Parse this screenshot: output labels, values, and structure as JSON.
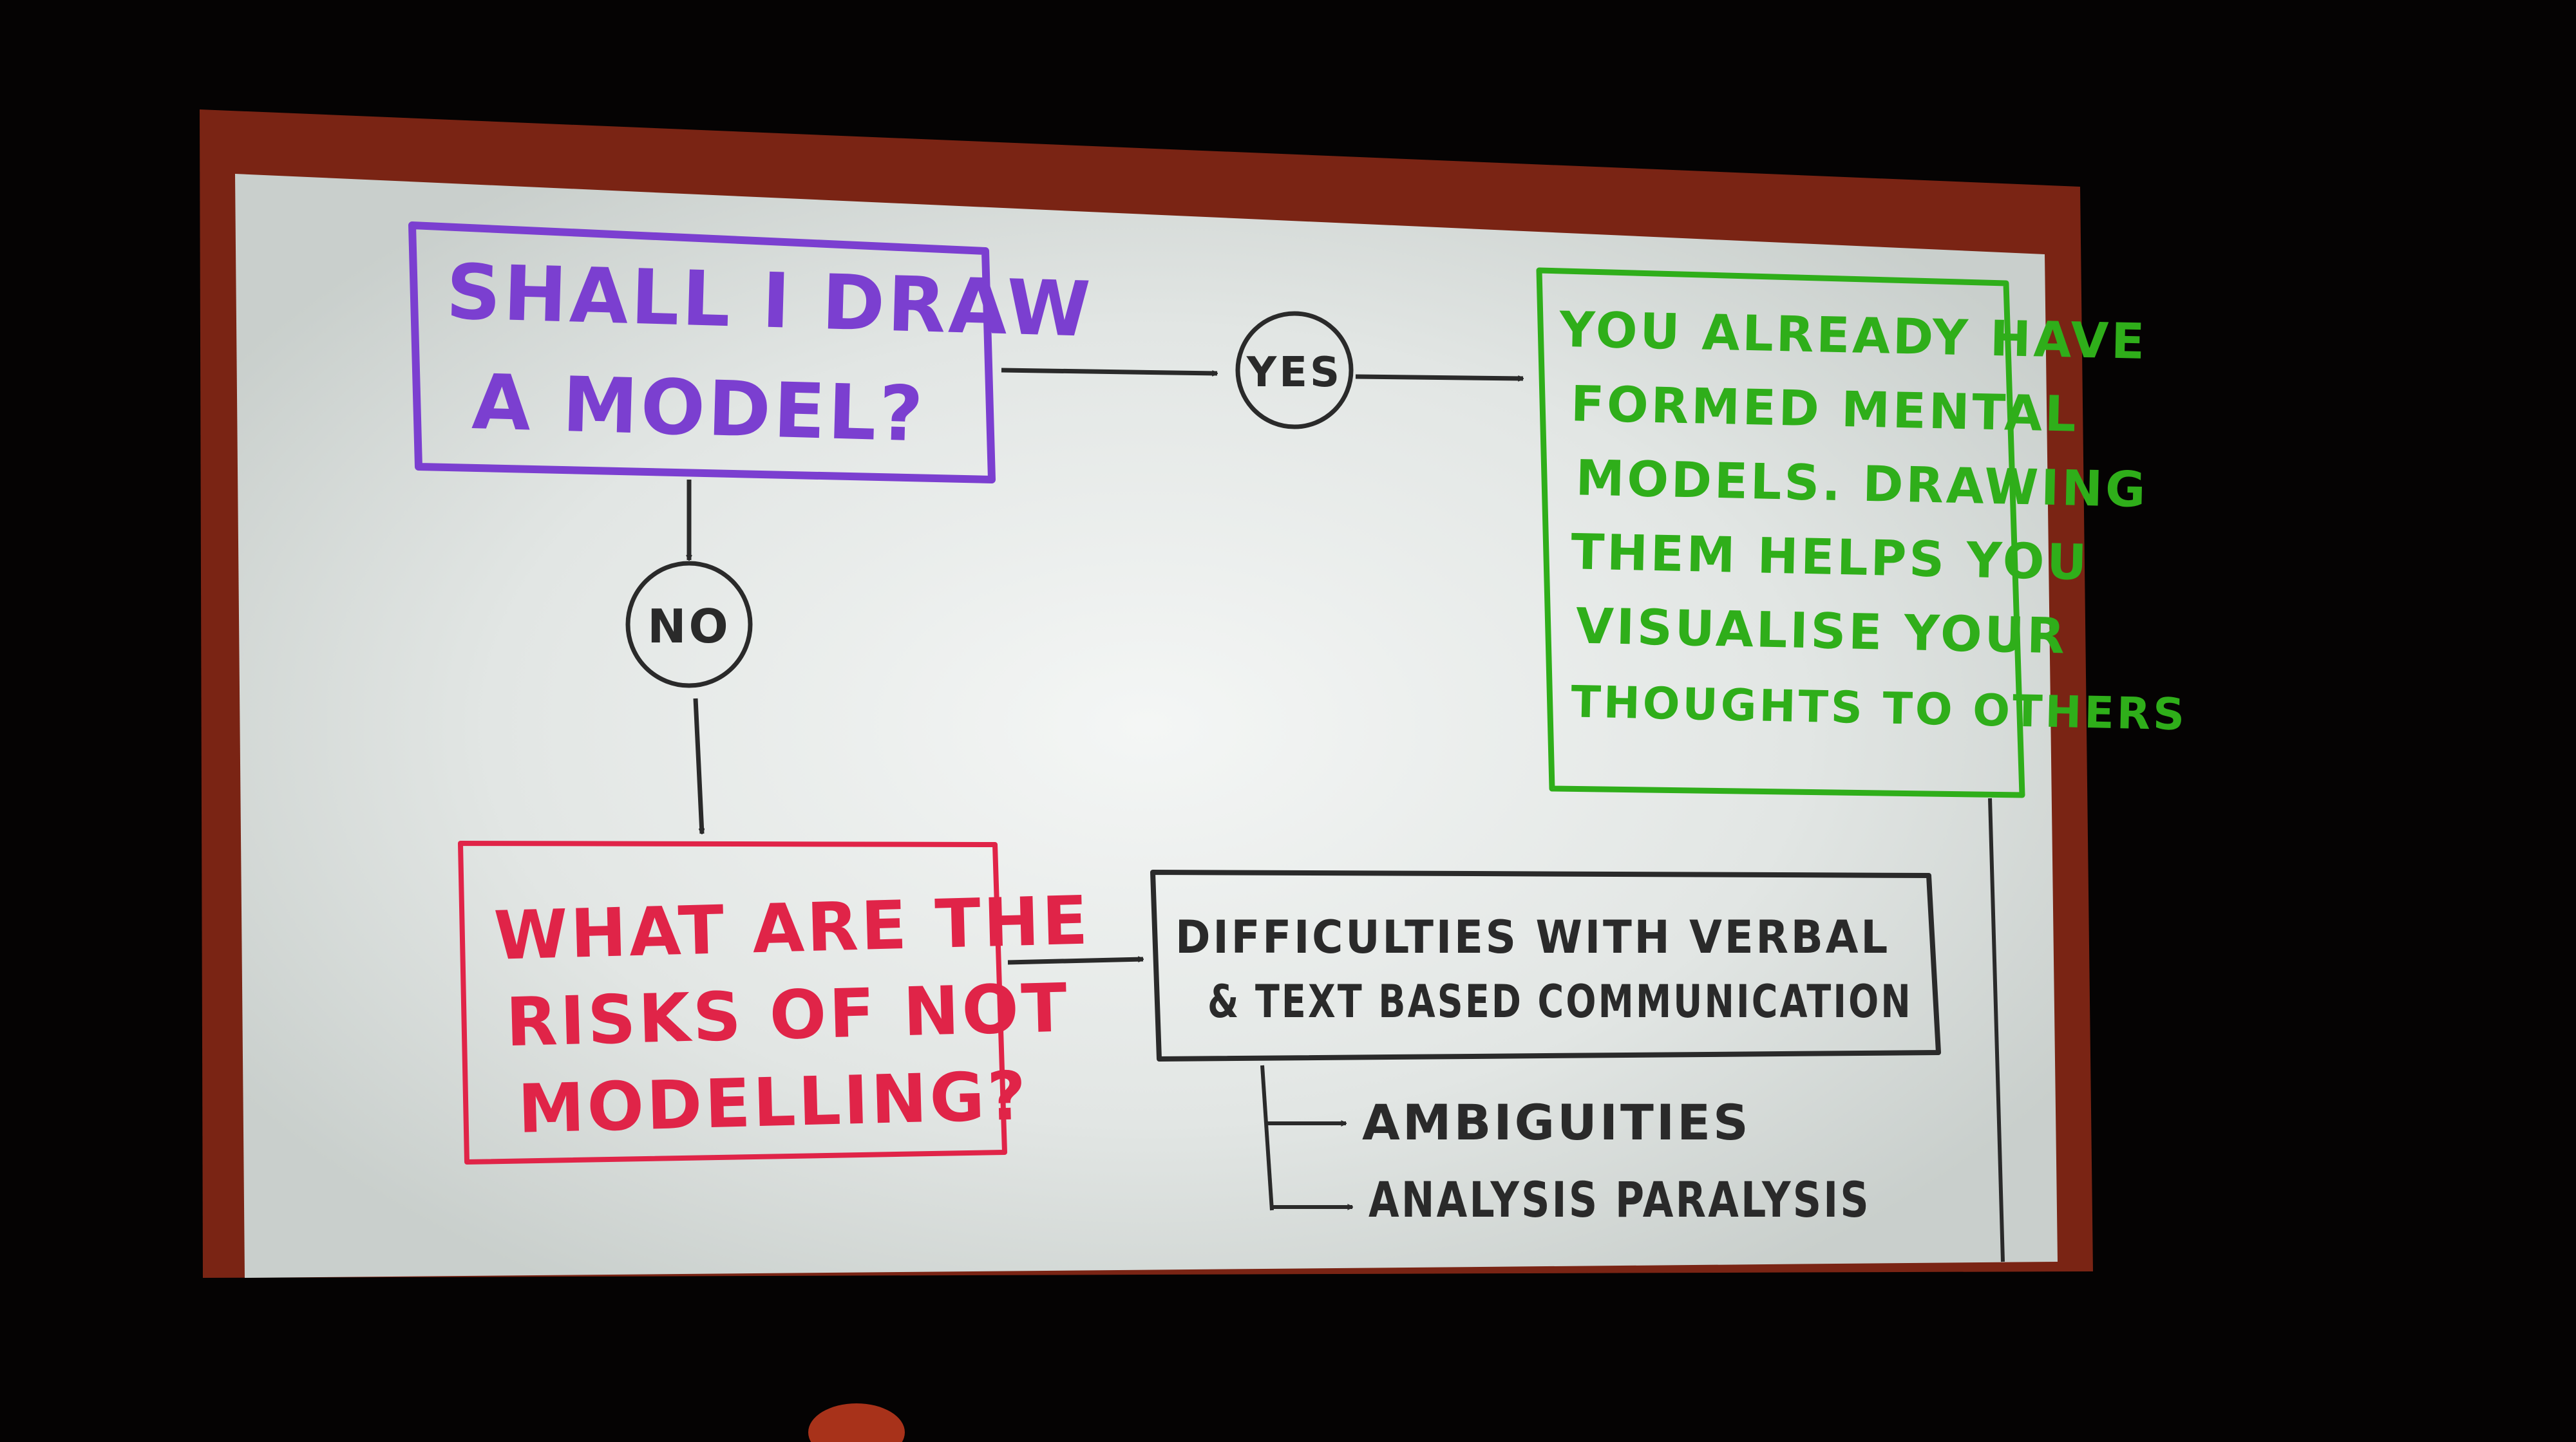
{
  "colors": {
    "background": "#050303",
    "screen_frame": "#7a2414",
    "slide": "#e4e8e6",
    "purple": "#7b3fd0",
    "green": "#2fae1a",
    "red": "#e02448",
    "ink": "#2a2a2a"
  },
  "nodes": {
    "question": {
      "lines": [
        "SHALL I DRAW",
        "A MODEL?"
      ]
    },
    "yes": {
      "label": "YES"
    },
    "no": {
      "label": "NO"
    },
    "mental_models": {
      "lines": [
        "YOU ALREADY HAVE",
        "FORMED MENTAL",
        "MODELS. DRAWING",
        "THEM HELPS YOU",
        "VISUALISE YOUR",
        "THOUGHTS TO OTHERS"
      ]
    },
    "risks": {
      "lines": [
        "WHAT ARE THE",
        "RISKS OF NOT",
        "MODELLING?"
      ]
    },
    "difficulties": {
      "lines": [
        "DIFFICULTIES WITH VERBAL",
        "& TEXT BASED COMMUNICATION"
      ]
    },
    "sub_items": [
      "AMBIGUITIES",
      "ANALYSIS PARALYSIS"
    ]
  }
}
